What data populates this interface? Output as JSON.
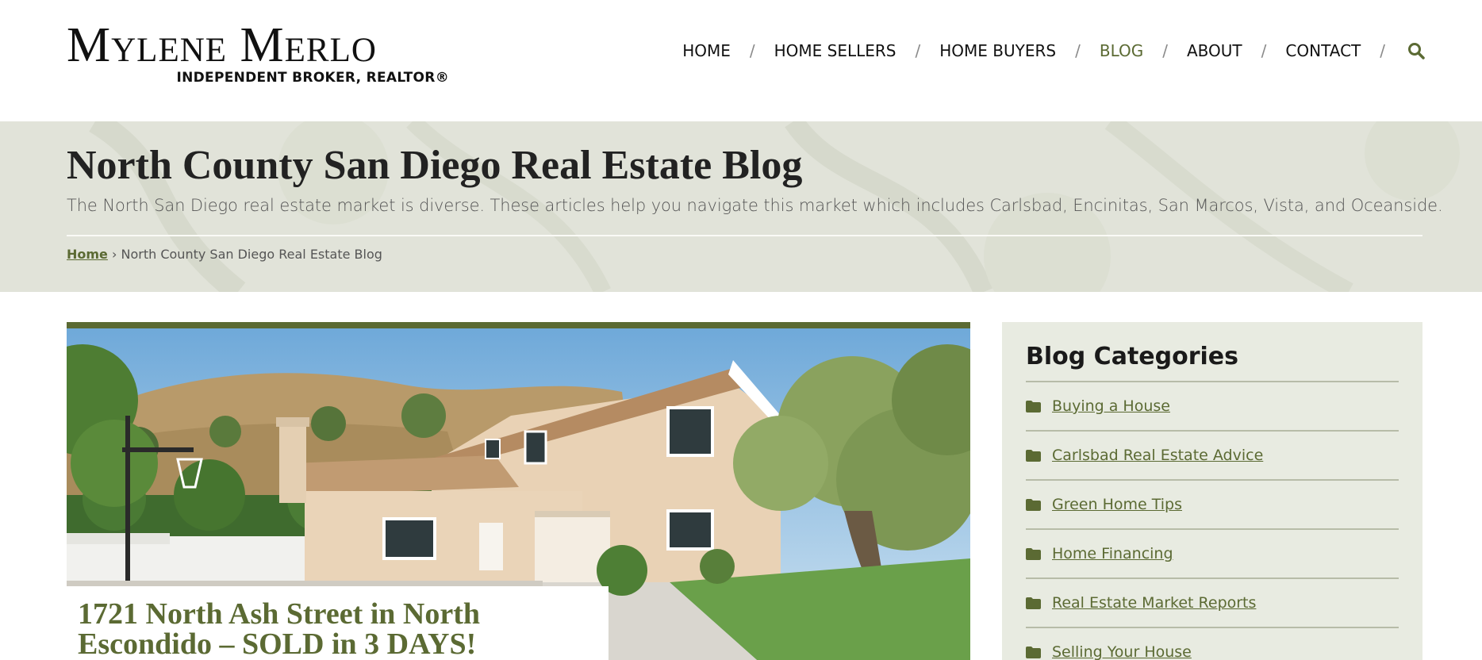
{
  "brand": {
    "name": "Mylene Merlo",
    "tagline": "INDEPENDENT BROKER, REALTOR®"
  },
  "nav": {
    "items": [
      {
        "label": "HOME",
        "active": false
      },
      {
        "label": "HOME SELLERS",
        "active": false
      },
      {
        "label": "HOME BUYERS",
        "active": false
      },
      {
        "label": "BLOG",
        "active": true
      },
      {
        "label": "ABOUT",
        "active": false
      },
      {
        "label": "CONTACT",
        "active": false
      }
    ],
    "separator": "/",
    "search_icon": "search-icon"
  },
  "banner": {
    "title": "North County San Diego Real Estate Blog",
    "description": "The North San Diego real estate market is diverse. These articles help you navigate this market which includes Carlsbad, Encinitas, San Marcos, Vista, and Oceanside.",
    "breadcrumb": {
      "home": "Home",
      "separator": "›",
      "current": "North County San Diego Real Estate Blog"
    }
  },
  "featured_post": {
    "title": "1721 North Ash Street in North Escondido – SOLD in 3 DAYS!"
  },
  "sidebar": {
    "title": "Blog Categories",
    "categories": [
      {
        "label": "Buying a House",
        "icon": "folder-icon"
      },
      {
        "label": "Carlsbad Real Estate Advice",
        "icon": "folder-icon"
      },
      {
        "label": "Green Home Tips",
        "icon": "folder-icon"
      },
      {
        "label": "Home Financing",
        "icon": "folder-icon"
      },
      {
        "label": "Real Estate Market Reports",
        "icon": "folder-icon"
      },
      {
        "label": "Selling Your House",
        "icon": "folder-icon"
      }
    ]
  },
  "colors": {
    "accent": "#5b6a33",
    "banner_bg": "#e2e4da",
    "sidebar_bg": "#e8ebe1"
  }
}
